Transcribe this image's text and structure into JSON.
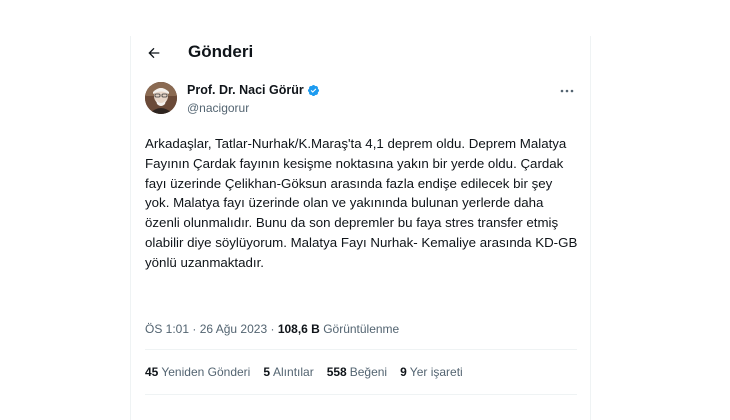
{
  "header": {
    "title": "Gönderi",
    "back_icon": "arrow-left-icon"
  },
  "author": {
    "display_name": "Prof. Dr. Naci Görür",
    "handle": "@nacigorur",
    "verified_color": "#1d9bf0"
  },
  "tweet": {
    "text": "Arkadaşlar, Tatlar-Nurhak/K.Maraş'ta 4,1 deprem oldu. Deprem Malatya\nFayının Çardak fayının kesişme noktasına yakın bir yerde oldu. Çardak\nfayı üzerinde Çelikhan-Göksun arasında fazla endişe edilecek bir şey\nyok. Malatya fayı üzerinde olan ve yakınında bulunan yerlerde daha\nözenli olunmalıdır. Bunu da son depremler bu faya stres transfer etmiş\nolabilir diye söylüyorum. Malatya Fayı Nurhak- Kemaliye arasında KD-GB\nyönlü uzanmaktadır."
  },
  "meta": {
    "time": "ÖS 1:01",
    "separator": "·",
    "date": "26 Ağu 2023",
    "views_count": "108,6 B",
    "views_label": "Görüntülenme"
  },
  "stats": {
    "retweets": {
      "count": "45",
      "label": "Yeniden Gönderi"
    },
    "quotes": {
      "count": "5",
      "label": "Alıntılar"
    },
    "likes": {
      "count": "558",
      "label": "Beğeni"
    },
    "bookmarks": {
      "count": "9",
      "label": "Yer işareti"
    }
  }
}
